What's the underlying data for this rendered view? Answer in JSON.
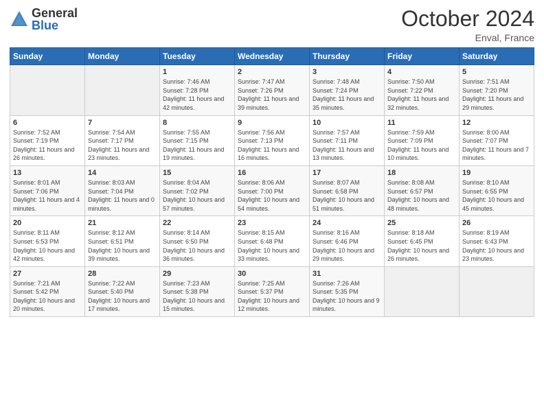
{
  "header": {
    "logo_general": "General",
    "logo_blue": "Blue",
    "month_title": "October 2024",
    "location": "Enval, France"
  },
  "weekdays": [
    "Sunday",
    "Monday",
    "Tuesday",
    "Wednesday",
    "Thursday",
    "Friday",
    "Saturday"
  ],
  "weeks": [
    [
      {
        "day": "",
        "sunrise": "",
        "sunset": "",
        "daylight": ""
      },
      {
        "day": "",
        "sunrise": "",
        "sunset": "",
        "daylight": ""
      },
      {
        "day": "1",
        "sunrise": "Sunrise: 7:46 AM",
        "sunset": "Sunset: 7:28 PM",
        "daylight": "Daylight: 11 hours and 42 minutes."
      },
      {
        "day": "2",
        "sunrise": "Sunrise: 7:47 AM",
        "sunset": "Sunset: 7:26 PM",
        "daylight": "Daylight: 11 hours and 39 minutes."
      },
      {
        "day": "3",
        "sunrise": "Sunrise: 7:48 AM",
        "sunset": "Sunset: 7:24 PM",
        "daylight": "Daylight: 11 hours and 35 minutes."
      },
      {
        "day": "4",
        "sunrise": "Sunrise: 7:50 AM",
        "sunset": "Sunset: 7:22 PM",
        "daylight": "Daylight: 11 hours and 32 minutes."
      },
      {
        "day": "5",
        "sunrise": "Sunrise: 7:51 AM",
        "sunset": "Sunset: 7:20 PM",
        "daylight": "Daylight: 11 hours and 29 minutes."
      }
    ],
    [
      {
        "day": "6",
        "sunrise": "Sunrise: 7:52 AM",
        "sunset": "Sunset: 7:19 PM",
        "daylight": "Daylight: 11 hours and 26 minutes."
      },
      {
        "day": "7",
        "sunrise": "Sunrise: 7:54 AM",
        "sunset": "Sunset: 7:17 PM",
        "daylight": "Daylight: 11 hours and 23 minutes."
      },
      {
        "day": "8",
        "sunrise": "Sunrise: 7:55 AM",
        "sunset": "Sunset: 7:15 PM",
        "daylight": "Daylight: 11 hours and 19 minutes."
      },
      {
        "day": "9",
        "sunrise": "Sunrise: 7:56 AM",
        "sunset": "Sunset: 7:13 PM",
        "daylight": "Daylight: 11 hours and 16 minutes."
      },
      {
        "day": "10",
        "sunrise": "Sunrise: 7:57 AM",
        "sunset": "Sunset: 7:11 PM",
        "daylight": "Daylight: 11 hours and 13 minutes."
      },
      {
        "day": "11",
        "sunrise": "Sunrise: 7:59 AM",
        "sunset": "Sunset: 7:09 PM",
        "daylight": "Daylight: 11 hours and 10 minutes."
      },
      {
        "day": "12",
        "sunrise": "Sunrise: 8:00 AM",
        "sunset": "Sunset: 7:07 PM",
        "daylight": "Daylight: 11 hours and 7 minutes."
      }
    ],
    [
      {
        "day": "13",
        "sunrise": "Sunrise: 8:01 AM",
        "sunset": "Sunset: 7:06 PM",
        "daylight": "Daylight: 11 hours and 4 minutes."
      },
      {
        "day": "14",
        "sunrise": "Sunrise: 8:03 AM",
        "sunset": "Sunset: 7:04 PM",
        "daylight": "Daylight: 11 hours and 0 minutes."
      },
      {
        "day": "15",
        "sunrise": "Sunrise: 8:04 AM",
        "sunset": "Sunset: 7:02 PM",
        "daylight": "Daylight: 10 hours and 57 minutes."
      },
      {
        "day": "16",
        "sunrise": "Sunrise: 8:06 AM",
        "sunset": "Sunset: 7:00 PM",
        "daylight": "Daylight: 10 hours and 54 minutes."
      },
      {
        "day": "17",
        "sunrise": "Sunrise: 8:07 AM",
        "sunset": "Sunset: 6:58 PM",
        "daylight": "Daylight: 10 hours and 51 minutes."
      },
      {
        "day": "18",
        "sunrise": "Sunrise: 8:08 AM",
        "sunset": "Sunset: 6:57 PM",
        "daylight": "Daylight: 10 hours and 48 minutes."
      },
      {
        "day": "19",
        "sunrise": "Sunrise: 8:10 AM",
        "sunset": "Sunset: 6:55 PM",
        "daylight": "Daylight: 10 hours and 45 minutes."
      }
    ],
    [
      {
        "day": "20",
        "sunrise": "Sunrise: 8:11 AM",
        "sunset": "Sunset: 6:53 PM",
        "daylight": "Daylight: 10 hours and 42 minutes."
      },
      {
        "day": "21",
        "sunrise": "Sunrise: 8:12 AM",
        "sunset": "Sunset: 6:51 PM",
        "daylight": "Daylight: 10 hours and 39 minutes."
      },
      {
        "day": "22",
        "sunrise": "Sunrise: 8:14 AM",
        "sunset": "Sunset: 6:50 PM",
        "daylight": "Daylight: 10 hours and 36 minutes."
      },
      {
        "day": "23",
        "sunrise": "Sunrise: 8:15 AM",
        "sunset": "Sunset: 6:48 PM",
        "daylight": "Daylight: 10 hours and 33 minutes."
      },
      {
        "day": "24",
        "sunrise": "Sunrise: 8:16 AM",
        "sunset": "Sunset: 6:46 PM",
        "daylight": "Daylight: 10 hours and 29 minutes."
      },
      {
        "day": "25",
        "sunrise": "Sunrise: 8:18 AM",
        "sunset": "Sunset: 6:45 PM",
        "daylight": "Daylight: 10 hours and 26 minutes."
      },
      {
        "day": "26",
        "sunrise": "Sunrise: 8:19 AM",
        "sunset": "Sunset: 6:43 PM",
        "daylight": "Daylight: 10 hours and 23 minutes."
      }
    ],
    [
      {
        "day": "27",
        "sunrise": "Sunrise: 7:21 AM",
        "sunset": "Sunset: 5:42 PM",
        "daylight": "Daylight: 10 hours and 20 minutes."
      },
      {
        "day": "28",
        "sunrise": "Sunrise: 7:22 AM",
        "sunset": "Sunset: 5:40 PM",
        "daylight": "Daylight: 10 hours and 17 minutes."
      },
      {
        "day": "29",
        "sunrise": "Sunrise: 7:23 AM",
        "sunset": "Sunset: 5:38 PM",
        "daylight": "Daylight: 10 hours and 15 minutes."
      },
      {
        "day": "30",
        "sunrise": "Sunrise: 7:25 AM",
        "sunset": "Sunset: 5:37 PM",
        "daylight": "Daylight: 10 hours and 12 minutes."
      },
      {
        "day": "31",
        "sunrise": "Sunrise: 7:26 AM",
        "sunset": "Sunset: 5:35 PM",
        "daylight": "Daylight: 10 hours and 9 minutes."
      },
      {
        "day": "",
        "sunrise": "",
        "sunset": "",
        "daylight": ""
      },
      {
        "day": "",
        "sunrise": "",
        "sunset": "",
        "daylight": ""
      }
    ]
  ]
}
